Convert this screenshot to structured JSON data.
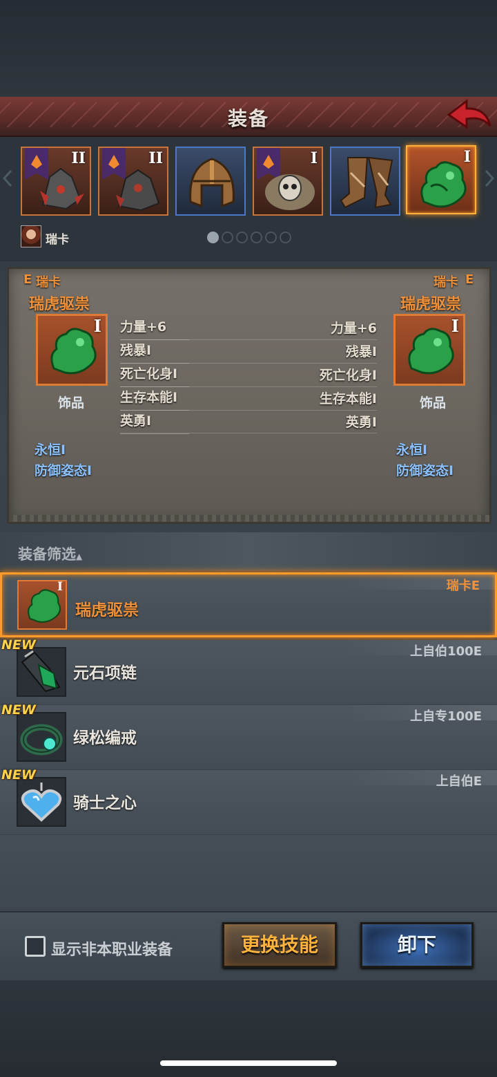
{
  "header": {
    "title": "装备"
  },
  "equip_slots": [
    {
      "rank": "II",
      "has_banner": true,
      "icon": "dark-helm-icon"
    },
    {
      "rank": "II",
      "has_banner": true,
      "icon": "dark-armor-icon"
    },
    {
      "rank": "",
      "has_banner": false,
      "icon": "bronze-helmet-icon"
    },
    {
      "rank": "I",
      "has_banner": true,
      "icon": "skull-pauldron-icon"
    },
    {
      "rank": "",
      "has_banner": false,
      "icon": "leather-boots-icon"
    },
    {
      "rank": "I",
      "has_banner": false,
      "icon": "jade-amulet-icon"
    }
  ],
  "character": {
    "name": "瑞卡"
  },
  "compare": {
    "left": {
      "owner": "瑞卡",
      "owner_mark": "E",
      "item_name": "瑞虎驱祟",
      "rank": "I",
      "type": "饰品",
      "stats": [
        "力量+6",
        "残暴I",
        "死亡化身I",
        "生存本能I",
        "英勇I"
      ],
      "blue_stats": [
        "永恒I",
        "防御姿态I"
      ]
    },
    "right": {
      "owner": "瑞卡",
      "owner_mark": "E",
      "item_name": "瑞虎驱祟",
      "rank": "I",
      "type": "饰品",
      "stats": [
        "力量+6",
        "残暴I",
        "死亡化身I",
        "生存本能I",
        "英勇I"
      ],
      "blue_stats": [
        "永恒I",
        "防御姿态I"
      ]
    }
  },
  "filter": {
    "label": "装备筛选",
    "arrow": "▲"
  },
  "items": [
    {
      "name": "瑞虎驱祟",
      "owner": "瑞卡E",
      "rank": "I",
      "is_new": false,
      "selected": true
    },
    {
      "name": "元石项链",
      "owner": "上自伯100E",
      "rank": "",
      "is_new": true,
      "selected": false
    },
    {
      "name": "绿松编戒",
      "owner": "上自专100E",
      "rank": "",
      "is_new": true,
      "selected": false
    },
    {
      "name": "骑士之心",
      "owner": "上自伯E",
      "rank": "",
      "is_new": true,
      "selected": false
    }
  ],
  "new_badge": "NEW",
  "bottom": {
    "checkbox_label": "显示非本职业装备",
    "skill_button": "更换技能",
    "unequip_button": "卸下"
  },
  "colors": {
    "orange": "#f1923b",
    "blue": "#8bc1ff",
    "header_red": "#7a3a35"
  }
}
